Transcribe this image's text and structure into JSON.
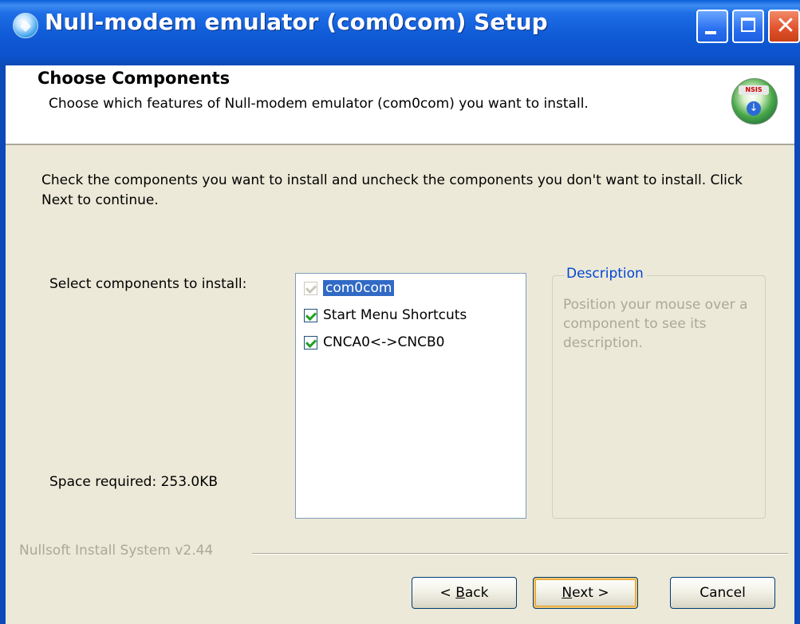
{
  "window": {
    "title": "Null-modem emulator (com0com) Setup",
    "controls": {
      "minimize_icon": "minimize-icon",
      "maximize_icon": "maximize-icon",
      "close_icon": "close-icon"
    }
  },
  "header": {
    "title": "Choose Components",
    "subtitle": "Choose which features of Null-modem emulator (com0com) you want to install.",
    "logo_icon": "nsis-installer-icon",
    "logo_tag": "NSIS"
  },
  "body": {
    "instructions": "Check the components you want to install and uncheck the components you don't want to install. Click Next to continue.",
    "select_label": "Select components to install:",
    "space_required": "Space required: 253.0KB",
    "components": [
      {
        "label": "com0com",
        "checked": true,
        "disabled": true,
        "selected": true
      },
      {
        "label": "Start Menu Shortcuts",
        "checked": true,
        "disabled": false,
        "selected": false
      },
      {
        "label": "CNCA0<->CNCB0",
        "checked": true,
        "disabled": false,
        "selected": false
      }
    ],
    "description": {
      "legend": "Description",
      "text": "Position your mouse over a component to see its description."
    }
  },
  "footer": {
    "branding": "Nullsoft Install System v2.44",
    "back_prefix": "< ",
    "back_accel": "B",
    "back_rest": "ack",
    "next_accel": "N",
    "next_rest": "ext >",
    "cancel": "Cancel"
  },
  "colors": {
    "titlebar": "#0b4ab8",
    "selection": "#316ac5",
    "check": "#21a121",
    "legend": "#0046d5",
    "disabled_text": "#aca899"
  }
}
